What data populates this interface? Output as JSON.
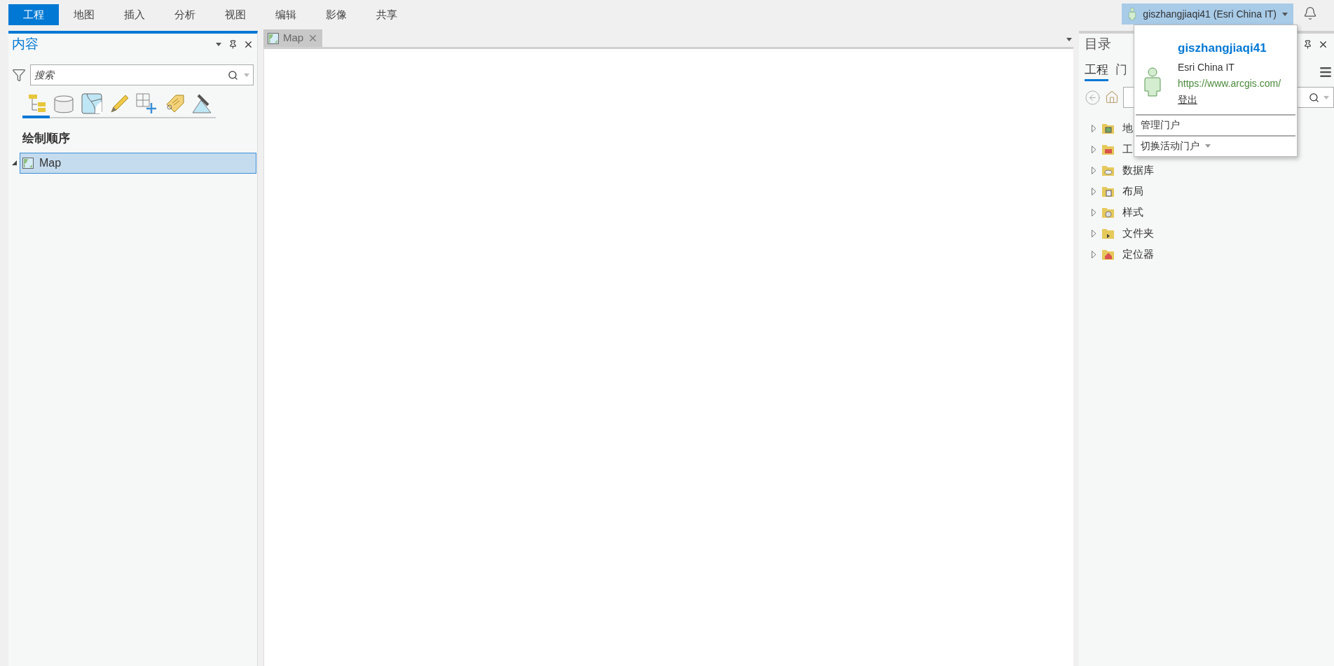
{
  "menu_tabs": [
    {
      "label": "工程",
      "selected": true
    },
    {
      "label": "地图",
      "selected": false
    },
    {
      "label": "插入",
      "selected": false
    },
    {
      "label": "分析",
      "selected": false
    },
    {
      "label": "视图",
      "selected": false
    },
    {
      "label": "编辑",
      "selected": false
    },
    {
      "label": "影像",
      "selected": false
    },
    {
      "label": "共享",
      "selected": false
    }
  ],
  "account": {
    "button_label": "giszhangjiaqi41 (Esri China IT)",
    "menu": {
      "username": "giszhangjiaqi41",
      "organization": "Esri China IT",
      "url": "https://www.arcgis.com/",
      "sign_out": "登出",
      "items": [
        {
          "label": "管理门户",
          "has_caret": false
        },
        {
          "label": "切换活动门户",
          "has_caret": true
        }
      ]
    }
  },
  "contents_pane": {
    "title": "内容",
    "search": {
      "placeholder": "搜索"
    },
    "view_tabs": [
      {
        "kind": "drawing-order",
        "selected": true
      },
      {
        "kind": "data-source",
        "selected": false
      },
      {
        "kind": "selection",
        "selected": false
      },
      {
        "kind": "editing",
        "selected": false
      },
      {
        "kind": "snapping",
        "selected": false
      },
      {
        "kind": "labeling",
        "selected": false
      },
      {
        "kind": "perspective",
        "selected": false
      }
    ],
    "section_title": "绘制顺序",
    "layers": [
      {
        "name": "Map",
        "expanded": true,
        "selected": true
      }
    ]
  },
  "map_view": {
    "tabs": [
      {
        "label": "Map",
        "selected": true
      }
    ]
  },
  "catalog_pane": {
    "title": "目录",
    "tabs": [
      {
        "label": "工程",
        "selected": true
      },
      {
        "label": "门",
        "selected": false
      }
    ],
    "items": [
      {
        "label": "地",
        "kind": "maps",
        "expanded": false
      },
      {
        "label": "工",
        "kind": "toolboxes",
        "expanded": false
      },
      {
        "label": "数据库",
        "kind": "databases",
        "expanded": false
      },
      {
        "label": "布局",
        "kind": "layouts",
        "expanded": false
      },
      {
        "label": "样式",
        "kind": "styles",
        "expanded": false
      },
      {
        "label": "文件夹",
        "kind": "folders",
        "expanded": false
      },
      {
        "label": "定位器",
        "kind": "locators",
        "expanded": false
      }
    ]
  }
}
